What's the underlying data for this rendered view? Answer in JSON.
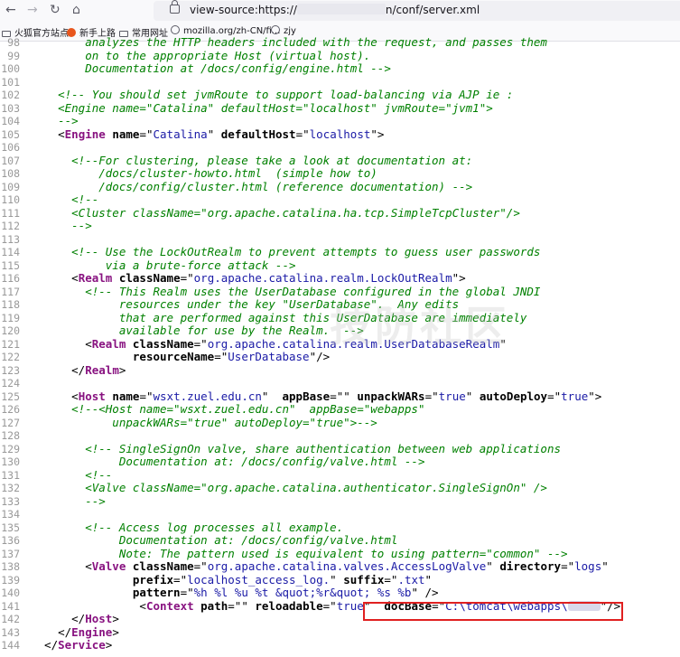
{
  "nav": {
    "back": "←",
    "forward": "→",
    "reload": "↻",
    "home": "⌂",
    "url_prefix": "view-source:https://",
    "url_suffix": "n/conf/server.xml"
  },
  "bookmarks": [
    {
      "label": "火狐官方站点",
      "icon": "folder-icon"
    },
    {
      "label": "新手上路",
      "icon": "firefox-icon"
    },
    {
      "label": "常用网址",
      "icon": "folder-icon"
    },
    {
      "label": "mozilla.org/zh-CN/fi...",
      "icon": "globe-icon"
    },
    {
      "label": "zjy",
      "icon": "globe-icon"
    }
  ],
  "watermark": "技防社区",
  "lines": [
    {
      "n": "98",
      "html": "<span class=\"c\">        analyzes the HTTP headers included with the request, and passes them</span>"
    },
    {
      "n": "99",
      "html": "<span class=\"c\">        on to the appropriate Host (virtual host).</span>"
    },
    {
      "n": "100",
      "html": "<span class=\"c\">        Documentation at /docs/config/engine.html --&gt;</span>"
    },
    {
      "n": "101",
      "html": ""
    },
    {
      "n": "102",
      "html": "<span class=\"c\">    &lt;!-- You should set jvmRoute to support load-balancing via AJP ie :</span>"
    },
    {
      "n": "103",
      "html": "<span class=\"c\">    &lt;Engine name=\"Catalina\" defaultHost=\"localhost\" jvmRoute=\"jvm1\"&gt;</span>"
    },
    {
      "n": "104",
      "html": "<span class=\"c\">    --&gt;</span>"
    },
    {
      "n": "105",
      "html": "    &lt;<span class=\"t\">Engine</span> <span class=\"a\">name</span>=\"<span class=\"v\">Catalina</span>\" <span class=\"a\">defaultHost</span>=\"<span class=\"v\">localhost</span>\"&gt;"
    },
    {
      "n": "106",
      "html": ""
    },
    {
      "n": "107",
      "html": "<span class=\"c\">      &lt;!--For clustering, please take a look at documentation at:</span>"
    },
    {
      "n": "108",
      "html": "<span class=\"c\">          /docs/cluster-howto.html  (simple how to)</span>"
    },
    {
      "n": "109",
      "html": "<span class=\"c\">          /docs/config/cluster.html (reference documentation) --&gt;</span>"
    },
    {
      "n": "110",
      "html": "<span class=\"c\">      &lt;!--</span>"
    },
    {
      "n": "111",
      "html": "<span class=\"c\">      &lt;Cluster className=\"org.apache.catalina.ha.tcp.SimpleTcpCluster\"/&gt;</span>"
    },
    {
      "n": "112",
      "html": "<span class=\"c\">      --&gt;</span>"
    },
    {
      "n": "113",
      "html": ""
    },
    {
      "n": "114",
      "html": "<span class=\"c\">      &lt;!-- Use the LockOutRealm to prevent attempts to guess user passwords</span>"
    },
    {
      "n": "115",
      "html": "<span class=\"c\">           via a brute-force attack --&gt;</span>"
    },
    {
      "n": "116",
      "html": "      &lt;<span class=\"t\">Realm</span> <span class=\"a\">className</span>=\"<span class=\"v\">org.apache.catalina.realm.LockOutRealm</span>\"&gt;"
    },
    {
      "n": "117",
      "html": "<span class=\"c\">        &lt;!-- This Realm uses the UserDatabase configured in the global JNDI</span>"
    },
    {
      "n": "118",
      "html": "<span class=\"c\">             resources under the key \"UserDatabase\".  Any edits</span>"
    },
    {
      "n": "119",
      "html": "<span class=\"c\">             that are performed against this UserDatabase are immediately</span>"
    },
    {
      "n": "120",
      "html": "<span class=\"c\">             available for use by the Realm.  --&gt;</span>"
    },
    {
      "n": "121",
      "html": "        &lt;<span class=\"t\">Realm</span> <span class=\"a\">className</span>=\"<span class=\"v\">org.apache.catalina.realm.UserDatabaseRealm</span>\""
    },
    {
      "n": "122",
      "html": "               <span class=\"a\">resourceName</span>=\"<span class=\"v\">UserDatabase</span>\"/&gt;"
    },
    {
      "n": "123",
      "html": "      &lt;/<span class=\"t\">Realm</span>&gt;"
    },
    {
      "n": "124",
      "html": ""
    },
    {
      "n": "125",
      "html": "      &lt;<span class=\"t\">Host</span> <span class=\"a\">name</span>=\"<span class=\"v\">wsxt.zuel.edu.cn</span>\"  <span class=\"a\">appBase</span>=\"<span class=\"v\"></span>\" <span class=\"a\">unpackWARs</span>=\"<span class=\"v\">true</span>\" <span class=\"a\">autoDeploy</span>=\"<span class=\"v\">true</span>\"&gt;"
    },
    {
      "n": "126",
      "html": "<span class=\"c\">      &lt;!--&lt;Host name=\"wsxt.zuel.edu.cn\"  appBase=\"webapps\"</span>"
    },
    {
      "n": "127",
      "html": "<span class=\"c\">            unpackWARs=\"true\" autoDeploy=\"true\"&gt;--&gt;</span>"
    },
    {
      "n": "128",
      "html": ""
    },
    {
      "n": "129",
      "html": "<span class=\"c\">        &lt;!-- SingleSignOn valve, share authentication between web applications</span>"
    },
    {
      "n": "130",
      "html": "<span class=\"c\">             Documentation at: /docs/config/valve.html --&gt;</span>"
    },
    {
      "n": "131",
      "html": "<span class=\"c\">        &lt;!--</span>"
    },
    {
      "n": "132",
      "html": "<span class=\"c\">        &lt;Valve className=\"org.apache.catalina.authenticator.SingleSignOn\" /&gt;</span>"
    },
    {
      "n": "133",
      "html": "<span class=\"c\">        --&gt;</span>"
    },
    {
      "n": "134",
      "html": ""
    },
    {
      "n": "135",
      "html": "<span class=\"c\">        &lt;!-- Access log processes all example.</span>"
    },
    {
      "n": "136",
      "html": "<span class=\"c\">             Documentation at: /docs/config/valve.html</span>"
    },
    {
      "n": "137",
      "html": "<span class=\"c\">             Note: The pattern used is equivalent to using pattern=\"common\" --&gt;</span>"
    },
    {
      "n": "138",
      "html": "        &lt;<span class=\"t\">Valve</span> <span class=\"a\">className</span>=\"<span class=\"v\">org.apache.catalina.valves.AccessLogValve</span>\" <span class=\"a\">directory</span>=\"<span class=\"v\">logs</span>\""
    },
    {
      "n": "139",
      "html": "               <span class=\"a\">prefix</span>=\"<span class=\"v\">localhost_access_log.</span>\" <span class=\"a\">suffix</span>=\"<span class=\"v\">.txt</span>\""
    },
    {
      "n": "140",
      "html": "               <span class=\"a\">pattern</span>=\"<span class=\"v\">%h %l %u %t &amp;quot;%r&amp;quot; %s %b</span>\" /&gt;"
    },
    {
      "n": "141",
      "html": "                &lt;<span class=\"t\">Context</span> <span class=\"a\">path</span>=\"<span class=\"v\"></span>\" <span class=\"a\">reloadable</span>=\"<span class=\"v\">true</span>\"  <span class=\"a\">docBase</span>=\"<span class=\"v\">C:\\tomcat\\webapps\\<span class=\"pathredact\"></span></span>\"/&gt;"
    },
    {
      "n": "142",
      "html": "      &lt;/<span class=\"t\">Host</span>&gt;"
    },
    {
      "n": "143",
      "html": "    &lt;/<span class=\"t\">Engine</span>&gt;"
    },
    {
      "n": "144",
      "html": "  &lt;/<span class=\"t\">Service</span>&gt;"
    }
  ]
}
